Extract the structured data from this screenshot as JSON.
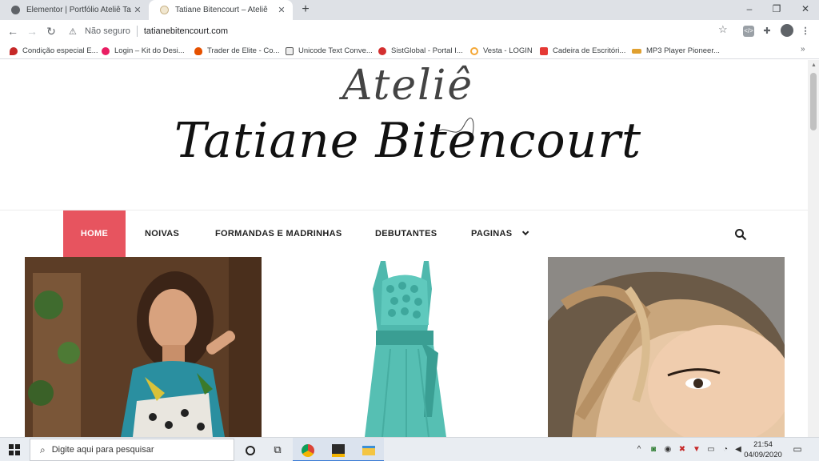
{
  "browser": {
    "tabs": [
      {
        "title": "Elementor | Portfólio Ateliê Tatiane",
        "active": false
      },
      {
        "title": "Tatiane Bitencourt – Ateliê",
        "active": true
      }
    ],
    "address": {
      "security_label": "Não seguro",
      "url": "tatianebitencourt.com"
    },
    "bookmarks": [
      {
        "label": "Condição especial E...",
        "icon": "red-drop-icon",
        "color": "#c62828"
      },
      {
        "label": "Login – Kit do Desi...",
        "icon": "pink-heart-icon",
        "color": "#e91e63"
      },
      {
        "label": "Trader de Elite - Co...",
        "icon": "flame-icon",
        "color": "#e65100"
      },
      {
        "label": "Unicode Text Conve...",
        "icon": "unicode-icon",
        "color": "#555555"
      },
      {
        "label": "SistGlobal - Portal I...",
        "icon": "sistglobal-icon",
        "color": "#d32f2f"
      },
      {
        "label": "Vesta - LOGIN",
        "icon": "vesta-icon",
        "color": "#f4a736"
      },
      {
        "label": "Cadeira de Escritóri...",
        "icon": "m-icon",
        "color": "#e53935"
      },
      {
        "label": "MP3 Player Pioneer...",
        "icon": "mp3-icon",
        "color": "#e0a030"
      }
    ]
  },
  "site": {
    "logo_top": "Ateliê",
    "logo_main": "Tatiane Bitencourt",
    "accent_color": "#e7545f",
    "nav": [
      {
        "label": "HOME",
        "active": true
      },
      {
        "label": "NOIVAS",
        "active": false
      },
      {
        "label": "FORMANDAS E MADRINHAS",
        "active": false
      },
      {
        "label": "DEBUTANTES",
        "active": false
      },
      {
        "label": "PAGINAS",
        "active": false,
        "has_dropdown": true
      }
    ],
    "photos": [
      {
        "subject": "woman-in-printed-dress-photo"
      },
      {
        "subject": "teal-ruffle-dress-photo"
      },
      {
        "subject": "woman-closeup-face-photo"
      }
    ]
  },
  "taskbar": {
    "search_placeholder": "Digite aqui para pesquisar",
    "time": "21:54",
    "date": "04/09/2020"
  }
}
